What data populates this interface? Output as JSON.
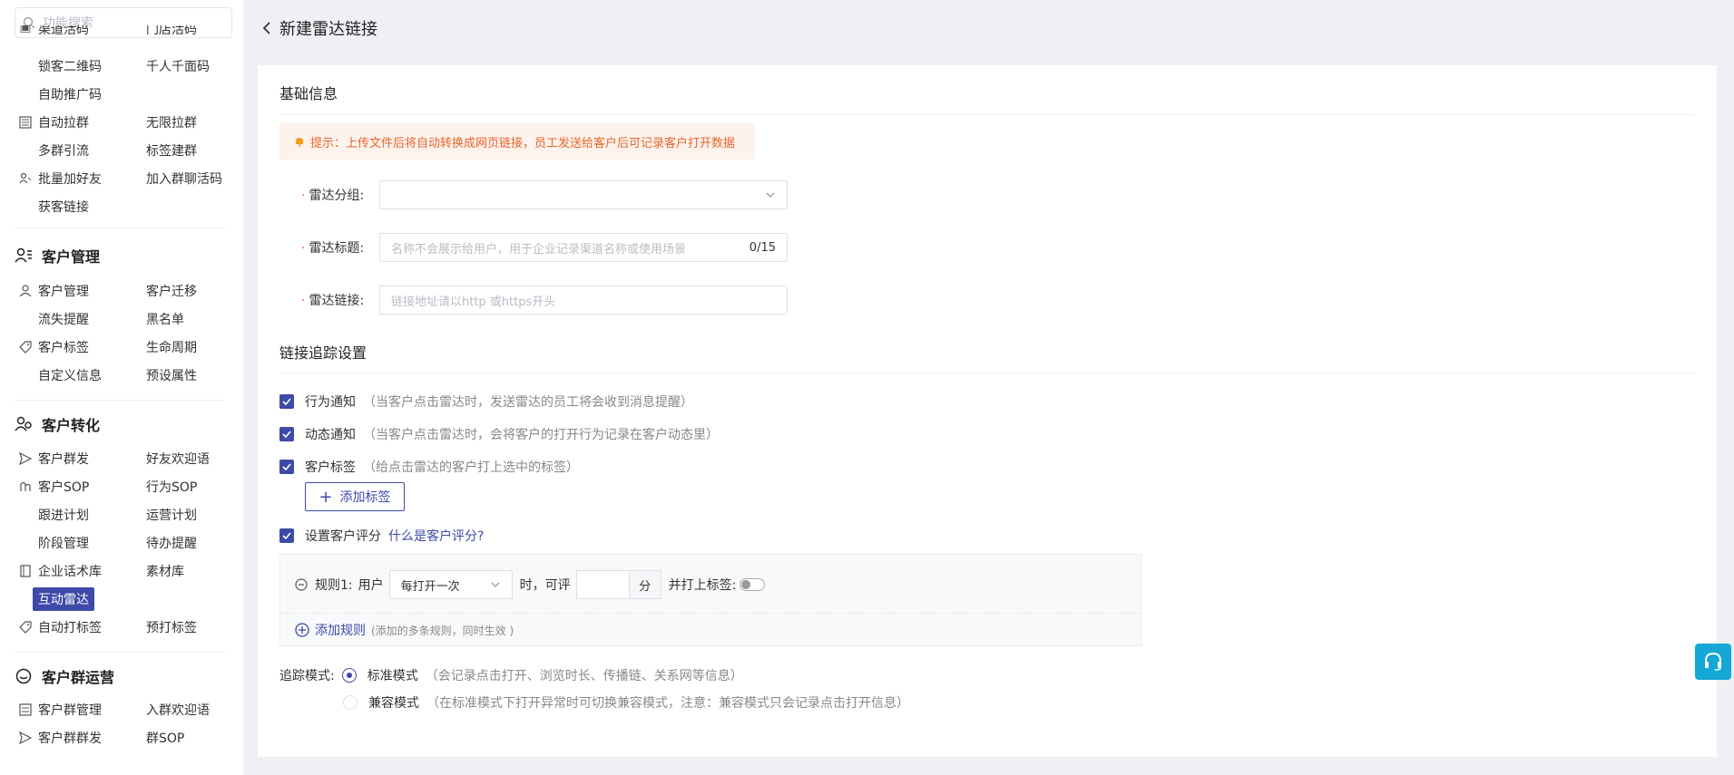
{
  "search": {
    "placeholder": "功能搜索"
  },
  "sidebar": {
    "partial_top": {
      "c1": "渠道活码",
      "c2": "门店活码"
    },
    "rows_group1": [
      {
        "c1": "锁客二维码",
        "c2": "千人千面码"
      },
      {
        "c1": "自助推广码",
        "c2": ""
      },
      {
        "c1": "自动拉群",
        "c2": "无限拉群"
      },
      {
        "c1": "多群引流",
        "c2": "标签建群"
      },
      {
        "c1": "批量加好友",
        "c2": "加入群聊活码"
      },
      {
        "c1": "获客链接",
        "c2": ""
      }
    ],
    "section_customer": "客户管理",
    "rows_customer": [
      {
        "c1": "客户管理",
        "c2": "客户迁移"
      },
      {
        "c1": "流失提醒",
        "c2": "黑名单"
      },
      {
        "c1": "客户标签",
        "c2": "生命周期"
      },
      {
        "c1": "自定义信息",
        "c2": "预设属性"
      }
    ],
    "section_convert": "客户转化",
    "rows_convert": [
      {
        "c1": "客户群发",
        "c2": "好友欢迎语"
      },
      {
        "c1": "客户SOP",
        "c2": "行为SOP"
      },
      {
        "c1": "跟进计划",
        "c2": "运营计划"
      },
      {
        "c1": "阶段管理",
        "c2": "待办提醒"
      },
      {
        "c1": "企业话术库",
        "c2": "素材库"
      },
      {
        "c1": "互动雷达",
        "c2": ""
      },
      {
        "c1": "自动打标签",
        "c2": "预打标签"
      }
    ],
    "section_group": "客户群运营",
    "rows_group": [
      {
        "c1": "客户群管理",
        "c2": "入群欢迎语"
      },
      {
        "c1": "客户群群发",
        "c2": "群SOP"
      }
    ]
  },
  "header": {
    "title": "新建雷达链接"
  },
  "basic": {
    "title": "基础信息",
    "tip": "提示：上传文件后将自动转换成网页链接，员工发送给客户后可记录客户打开数据",
    "group_label": "雷达分组:",
    "title_label": "雷达标题:",
    "title_placeholder": "名称不会展示给用户，用于企业记录渠道名称或使用场景",
    "title_count": "0/15",
    "link_label": "雷达链接:",
    "link_placeholder": "链接地址请以http 或https开头"
  },
  "tracking": {
    "title": "链接追踪设置",
    "behavior": {
      "label": "行为通知",
      "hint": "（当客户点击雷达时，发送雷达的员工将会收到消息提醒）"
    },
    "dynamic": {
      "label": "动态通知",
      "hint": "（当客户点击雷达时，会将客户的打开行为记录在客户动态里）"
    },
    "tag": {
      "label": "客户标签",
      "hint": "（给点击雷达的客户打上选中的标签）"
    },
    "add_tag": "添加标签",
    "score": {
      "label": "设置客户评分",
      "link": "什么是客户评分?"
    },
    "rule": {
      "name": "规则1:",
      "user": "用户",
      "select": "每打开一次",
      "when": "时，可评",
      "unit": "分",
      "tag_label": "并打上标签:"
    },
    "add_rule": "添加规则",
    "add_rule_hint": "(添加的多条规则，同时生效 )",
    "mode_label": "追踪模式:",
    "standard": {
      "label": "标准模式",
      "hint": "（会记录点击打开、浏览时长、传播链、关系网等信息）"
    },
    "compat": {
      "label": "兼容模式",
      "hint": "（在标准模式下打开异常时可切换兼容模式，注意：兼容模式只会记录点击打开信息）"
    }
  },
  "colors": {
    "accent": "#3d4aa8",
    "tip_bg": "#fdf2ec",
    "tip_text": "#e5652c",
    "float": "#13a8d6"
  }
}
